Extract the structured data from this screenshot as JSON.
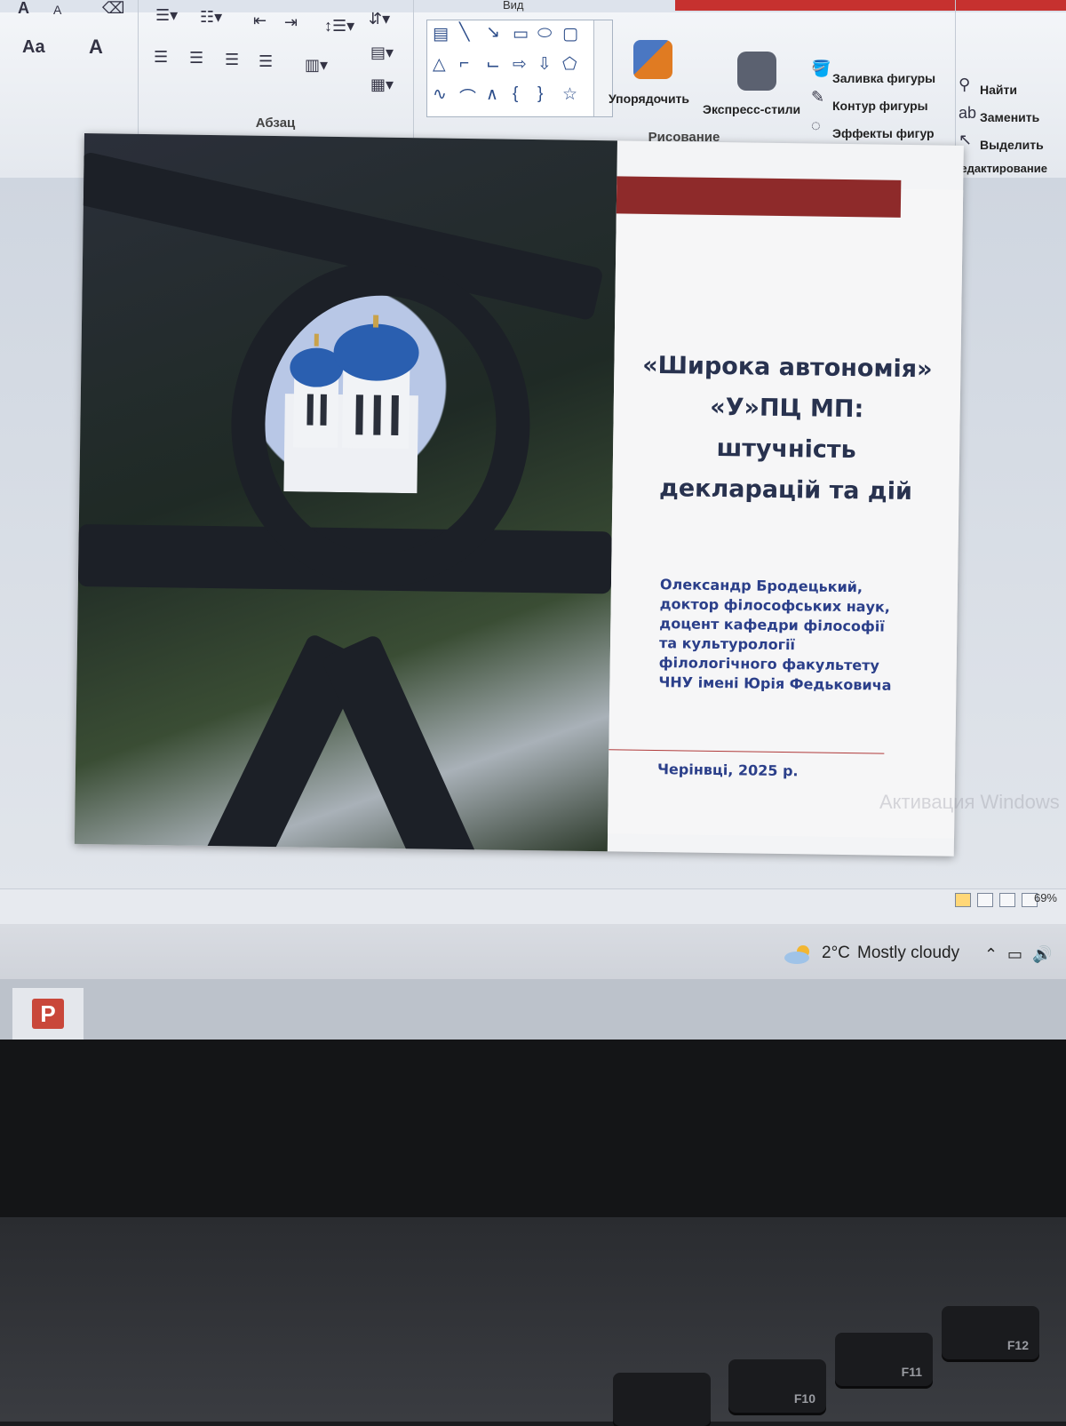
{
  "ribbon": {
    "tab_view": "Вид",
    "groups": {
      "paragraph": {
        "label": "Абзац"
      },
      "drawing": {
        "label": "Рисование",
        "arrange": "Упорядочить",
        "quick_styles": "Экспресс-стили",
        "shape_fill": "Заливка фигуры",
        "shape_outline": "Контур фигуры",
        "shape_effects": "Эффекты фигур"
      },
      "editing": {
        "label": "Редактирование",
        "find": "Найти",
        "replace": "Заменить",
        "select": "Выделить"
      },
      "font": {
        "size_label": "Aa"
      }
    }
  },
  "slide": {
    "title_lines": [
      "«Широка автономія»",
      "«У»ПЦ МП:",
      "штучність",
      "декларацій та дій"
    ],
    "author_lines": [
      "Олександр Бродецький,",
      "доктор філософських наук,",
      "доцент кафедри філософії",
      "та культурології",
      "філологічного факультету",
      "ЧНУ імені Юрія Федьковича"
    ],
    "place_date": "Черінвці, 2025 р.",
    "watermark": "Активация Windows"
  },
  "statusbar": {
    "zoom": "69%"
  },
  "taskbar": {
    "app_icon": "powerpoint-icon",
    "weather": {
      "temp": "2°C",
      "desc": "Mostly cloudy",
      "icon": "partly-cloudy-icon"
    }
  },
  "keyboard": {
    "keys": [
      "F10",
      "F11",
      "F12"
    ]
  },
  "colors": {
    "slide_title": "#28324f",
    "slide_text": "#2b3f8a",
    "accent_red": "#8e2a2a"
  }
}
